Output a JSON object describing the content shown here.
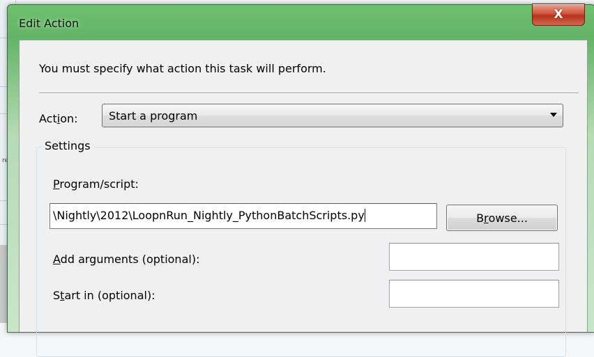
{
  "background": {
    "fragment_text": "re"
  },
  "dialog": {
    "title": "Edit Action",
    "close_label": "X",
    "instruction": "You must specify what action this task will perform.",
    "action": {
      "label_pre": "Act",
      "label_key": "i",
      "label_post": "on:",
      "selected": "Start a program"
    },
    "settings": {
      "title": "Settings",
      "program": {
        "label_key": "P",
        "label_rest": "rogram/script:",
        "value": "\\Nightly\\2012\\LoopnRun_Nightly_PythonBatchScripts.py"
      },
      "browse": {
        "label_pre": "B",
        "label_key": "r",
        "label_post": "owse..."
      },
      "arguments": {
        "label_key": "A",
        "label_rest": "dd arguments (optional):",
        "value": ""
      },
      "start_in": {
        "label_pre": "S",
        "label_key": "t",
        "label_post": "art in (optional):",
        "value": ""
      }
    }
  },
  "colors": {
    "title_glass": "#64b468",
    "close_red": "#d1553b",
    "client_bg": "#f0f0f0"
  }
}
